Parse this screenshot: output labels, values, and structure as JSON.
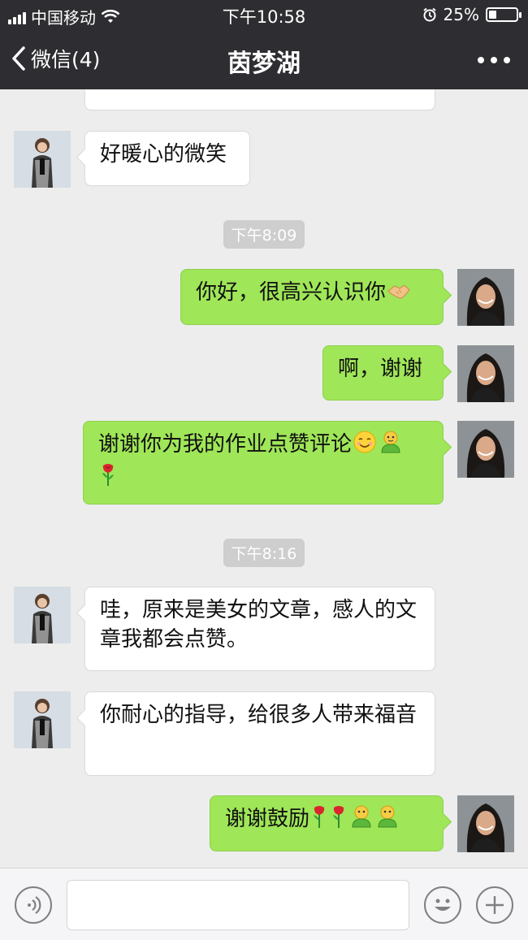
{
  "status_bar": {
    "carrier": "中国移动",
    "time": "下午10:58",
    "battery": "25%",
    "battery_level": 0.25
  },
  "nav": {
    "back_label": "微信(4)",
    "title": "茵梦湖"
  },
  "messages": [
    {
      "id": "m0",
      "side": "in",
      "text": ""
    },
    {
      "id": "m1",
      "side": "in",
      "text": "好暖心的微笑"
    },
    {
      "id": "t1",
      "type": "time",
      "text": "下午8:09"
    },
    {
      "id": "m2",
      "side": "out",
      "text": "你好，很高兴认识你",
      "emoji": [
        "handshake-emoji"
      ]
    },
    {
      "id": "m3",
      "side": "out",
      "text": "啊，谢谢"
    },
    {
      "id": "m4",
      "side": "out",
      "text": "谢谢你为我的作业点赞评论",
      "emoji": [
        "smile-emoji",
        "green-figure-emoji",
        "rose-emoji"
      ]
    },
    {
      "id": "t2",
      "type": "time",
      "text": "下午8:16"
    },
    {
      "id": "m5",
      "side": "in",
      "text": "哇，原来是美女的文章，感人的文章我都会点赞。"
    },
    {
      "id": "m6",
      "side": "in",
      "text": "你耐心的指导，给很多人带来福音"
    },
    {
      "id": "m7",
      "side": "out",
      "text": "谢谢鼓励",
      "emoji": [
        "rose-emoji",
        "rose-emoji",
        "green-figure-emoji",
        "green-figure-emoji"
      ]
    }
  ],
  "icons": [
    "back-chevron-icon",
    "more-icon",
    "voice-icon",
    "emoji-face-icon",
    "plus-icon",
    "wifi-icon",
    "alarm-icon"
  ]
}
